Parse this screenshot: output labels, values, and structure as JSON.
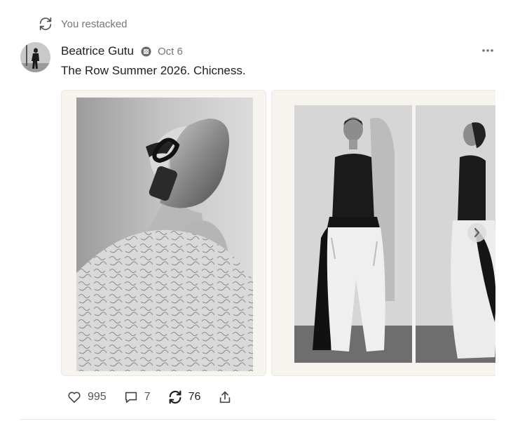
{
  "restack": {
    "label": "You restacked",
    "icon": "restack-icon"
  },
  "post": {
    "author": "Beatrice Gutu",
    "date": "Oct 6",
    "text": "The Row Summer 2026. Chicness."
  },
  "actions": {
    "likes": "995",
    "comments": "7",
    "restacks": "76"
  },
  "colors": {
    "muted_text": "#757575",
    "primary_text": "#1f1f1f",
    "card_bg": "#f7f3ee"
  }
}
